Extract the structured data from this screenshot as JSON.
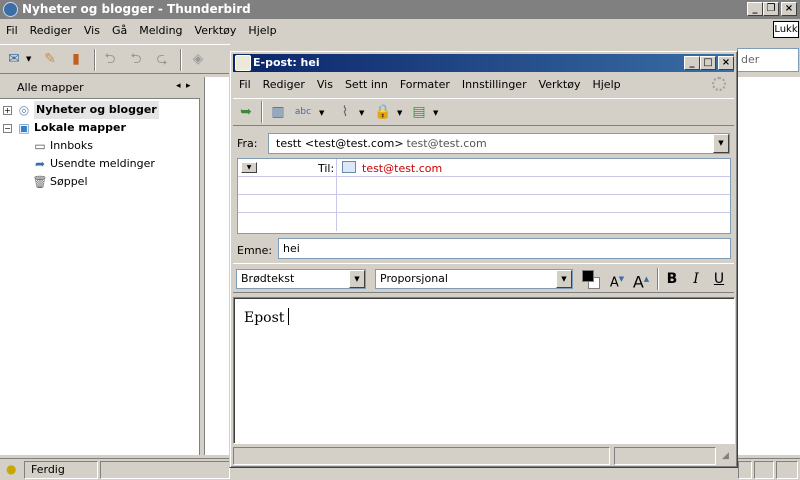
{
  "main": {
    "title": "Nyheter og blogger - Thunderbird",
    "menu": [
      "Fil",
      "Rediger",
      "Vis",
      "Gå",
      "Melding",
      "Verktøy",
      "Hjelp"
    ],
    "tooltip": "Lukk",
    "search_placeholder": "der",
    "folder_header": "Alle mapper",
    "folders": [
      {
        "label": "Nyheter og blogger",
        "icon": "rss-folder-icon",
        "bold": true
      },
      {
        "label": "Lokale mapper",
        "icon": "computer-icon",
        "bold": true
      },
      {
        "label": "Innboks",
        "icon": "inbox-icon",
        "bold": false
      },
      {
        "label": "Usendte meldinger",
        "icon": "outbox-icon",
        "bold": false
      },
      {
        "label": "Søppel",
        "icon": "trash-icon",
        "bold": false
      }
    ],
    "status": "Ferdig"
  },
  "compose": {
    "title": "E-post: hei",
    "menu": [
      "Fil",
      "Rediger",
      "Vis",
      "Sett inn",
      "Formater",
      "Innstillinger",
      "Verktøy",
      "Hjelp"
    ],
    "from_label": "Fra:",
    "from_value": "testt <test@test.com>",
    "from_account": "- test@test.com",
    "to_label": "Til:",
    "to_value": "test@test.com",
    "subject_label": "Emne:",
    "subject_value": "hei",
    "paragraph_style": "Brødtekst",
    "font": "Proporsjonal",
    "bold_label": "B",
    "italic_label": "I",
    "underline_label": "U",
    "smaller_label": "A",
    "larger_label": "A",
    "body": "Epost"
  },
  "colors": {
    "active_title": "#0a246a",
    "inactive_title": "#808080",
    "recipient": "#cc0000",
    "chrome": "#d4d0c8"
  }
}
